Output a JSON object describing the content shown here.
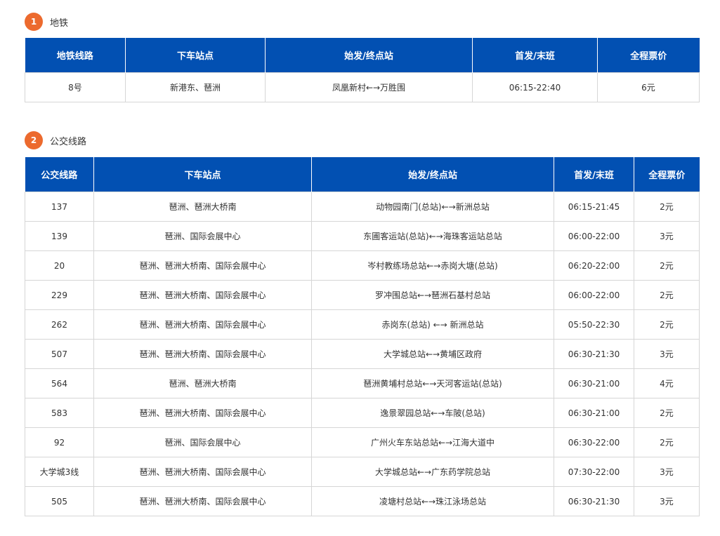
{
  "sections": [
    {
      "number": "1",
      "title": "地铁"
    },
    {
      "number": "2",
      "title": "公交线路"
    }
  ],
  "metro": {
    "headers": [
      "地铁线路",
      "下车站点",
      "始发/终点站",
      "首发/末班",
      "全程票价"
    ],
    "rows": [
      [
        "8号",
        "新港东、琶洲",
        "凤凰新村←→万胜围",
        "06:15-22:40",
        "6元"
      ]
    ]
  },
  "bus": {
    "headers": [
      "公交线路",
      "下车站点",
      "始发/终点站",
      "首发/末班",
      "全程票价"
    ],
    "rows": [
      [
        "137",
        "琶洲、琶洲大桥南",
        "动物园南门(总站)←→新洲总站",
        "06:15-21:45",
        "2元"
      ],
      [
        "139",
        "琶洲、国际会展中心",
        "东圃客运站(总站)←→海珠客运站总站",
        "06:00-22:00",
        "3元"
      ],
      [
        "20",
        "琶洲、琶洲大桥南、国际会展中心",
        "岑村教练场总站←→赤岗大塘(总站)",
        "06:20-22:00",
        "2元"
      ],
      [
        "229",
        "琶洲、琶洲大桥南、国际会展中心",
        "罗冲围总站←→琶洲石基村总站",
        "06:00-22:00",
        "2元"
      ],
      [
        "262",
        "琶洲、琶洲大桥南、国际会展中心",
        "赤岗东(总站) ←→ 新洲总站",
        "05:50-22:30",
        "2元"
      ],
      [
        "507",
        "琶洲、琶洲大桥南、国际会展中心",
        "大学城总站←→黄埔区政府",
        "06:30-21:30",
        "3元"
      ],
      [
        "564",
        "琶洲、琶洲大桥南",
        "琶洲黄埔村总站←→天河客运站(总站)",
        "06:30-21:00",
        "4元"
      ],
      [
        "583",
        "琶洲、琶洲大桥南、国际会展中心",
        "逸景翠园总站←→车陂(总站)",
        "06:30-21:00",
        "2元"
      ],
      [
        "92",
        "琶洲、国际会展中心",
        "广州火车东站总站←→江海大道中",
        "06:30-22:00",
        "2元"
      ],
      [
        "大学城3线",
        "琶洲、琶洲大桥南、国际会展中心",
        "大学城总站←→广东药学院总站",
        "07:30-22:00",
        "3元"
      ],
      [
        "505",
        "琶洲、琶洲大桥南、国际会展中心",
        "凌塘村总站←→珠江泳场总站",
        "06:30-21:30",
        "3元"
      ]
    ]
  }
}
